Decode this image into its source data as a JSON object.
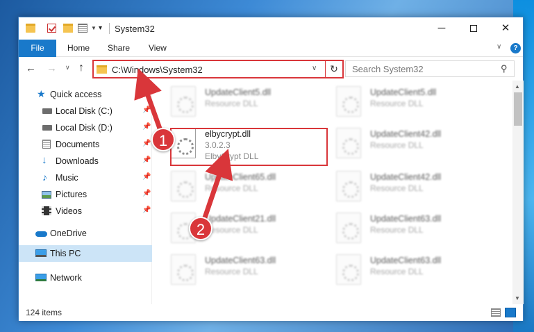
{
  "window": {
    "title": "System32",
    "minimize_glyph": "─",
    "maximize_glyph": "",
    "close_glyph": "✕"
  },
  "ribbon": {
    "file": "File",
    "home": "Home",
    "share": "Share",
    "view": "View"
  },
  "nav": {
    "address": "C:\\Windows\\System32",
    "search_placeholder": "Search System32"
  },
  "sidebar": {
    "items": [
      {
        "label": "Quick access",
        "icon": "star-icon"
      },
      {
        "label": "Local Disk (C:)",
        "icon": "drive-icon",
        "pinned": true
      },
      {
        "label": "Local Disk (D:)",
        "icon": "drive-icon",
        "pinned": true
      },
      {
        "label": "Documents",
        "icon": "documents-icon",
        "pinned": true
      },
      {
        "label": "Downloads",
        "icon": "downloads-icon",
        "pinned": true
      },
      {
        "label": "Music",
        "icon": "music-icon",
        "pinned": true
      },
      {
        "label": "Pictures",
        "icon": "pictures-icon",
        "pinned": true
      },
      {
        "label": "Videos",
        "icon": "videos-icon",
        "pinned": true
      },
      {
        "label": "OneDrive",
        "icon": "cloud-icon"
      },
      {
        "label": "This PC",
        "icon": "computer-icon",
        "selected": true
      },
      {
        "label": "Network",
        "icon": "network-icon"
      }
    ]
  },
  "files": {
    "left": [
      {
        "name": "UpdateClient5.dll",
        "line1": "Resource DLL",
        "line2": ""
      },
      {
        "name": "elbycrypt.dll",
        "line1": "3.0.2.3",
        "line2": "ElbyCrypt DLL"
      },
      {
        "name": "UpdateClient65.dll",
        "line1": "Resource DLL",
        "line2": ""
      },
      {
        "name": "UpdateClient21.dll",
        "line1": "Resource DLL",
        "line2": ""
      },
      {
        "name": "UpdateClient63.dll",
        "line1": "Resource DLL",
        "line2": ""
      }
    ],
    "right": [
      {
        "name": "UpdateClient5.dll",
        "line1": "Resource DLL"
      },
      {
        "name": "UpdateClient42.dll",
        "line1": "Resource DLL"
      },
      {
        "name": "UpdateClient42.dll",
        "line1": "Resource DLL"
      },
      {
        "name": "UpdateClient63.dll",
        "line1": "Resource DLL"
      },
      {
        "name": "UpdateClient63.dll",
        "line1": "Resource DLL"
      }
    ]
  },
  "status": {
    "count": "124 items"
  },
  "annotations": {
    "step1": "1",
    "step2": "2"
  },
  "colors": {
    "accent": "#1979ca",
    "highlight": "#d9363a",
    "selected": "#cce4f7"
  }
}
